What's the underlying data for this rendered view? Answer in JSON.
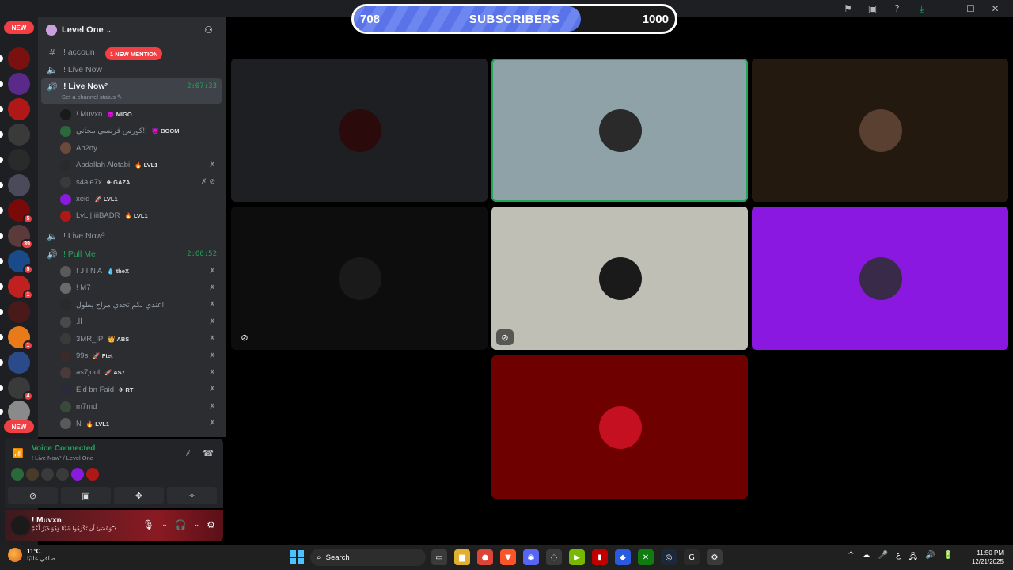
{
  "window": {
    "icons": [
      "flag-icon",
      "inbox-icon",
      "help-icon",
      "download-icon",
      "minimize-icon",
      "maximize-icon",
      "close-icon"
    ]
  },
  "subscriber_goal": {
    "current": "708",
    "label": "SUBSCRIBERS",
    "goal": "1000",
    "progress": 0.708,
    "fill_color": "#5a73e8"
  },
  "rail": {
    "new_top": "NEW",
    "new_bottom": "NEW",
    "servers": [
      {
        "name": "server-1",
        "badge": "",
        "color": "#7a1010"
      },
      {
        "name": "server-2",
        "badge": "",
        "color": "#5a2a8a"
      },
      {
        "name": "server-3",
        "badge": "",
        "color": "#b01818"
      },
      {
        "name": "server-4",
        "badge": "",
        "color": "#3a3a3a"
      },
      {
        "name": "server-5",
        "badge": "",
        "color": "#2a2a2a"
      },
      {
        "name": "server-6",
        "badge": "",
        "color": "#4a4a5a"
      },
      {
        "name": "server-7",
        "badge": "5",
        "color": "#7a0a0a"
      },
      {
        "name": "server-8",
        "badge": "39",
        "color": "#5a3a3a"
      },
      {
        "name": "server-9",
        "badge": "5",
        "color": "#1a4a8a"
      },
      {
        "name": "server-10",
        "badge": "1",
        "color": "#c02020"
      },
      {
        "name": "server-11",
        "badge": "",
        "color": "#4a1a1a"
      },
      {
        "name": "server-12",
        "badge": "1",
        "color": "#e87a1a"
      },
      {
        "name": "server-13",
        "badge": "",
        "color": "#2a4a8a"
      },
      {
        "name": "server-14",
        "badge": "4",
        "color": "#3a3a3a"
      },
      {
        "name": "server-15",
        "badge": "",
        "color": "#8a8a8a"
      }
    ]
  },
  "guild": {
    "name": "Level One",
    "mention_pill": "1 NEW MENTION"
  },
  "channels": [
    {
      "prefix": "#",
      "name": "! accoun",
      "type": "text"
    },
    {
      "prefix": "🔊",
      "name": "! Live Now",
      "type": "voice"
    },
    {
      "prefix": "🔊",
      "name": "! Live Now²",
      "type": "voice-active",
      "timer": "2:07:33",
      "status": "Set a channel status ✎"
    },
    {
      "prefix": "🔊",
      "name": "! Live Now³",
      "type": "voice"
    },
    {
      "prefix": "🔊",
      "name": "! Pull Me",
      "type": "voice-live",
      "timer": "2:06:52"
    }
  ],
  "members_live_now_2": [
    {
      "name": "! Muvxn",
      "tag": "😈 MIGO",
      "status": "",
      "color": "#1a1a1a"
    },
    {
      "name": "كورس فرنسي مجاني!!",
      "tag": "😈 BOOM",
      "status": "",
      "color": "#2a6a3a"
    },
    {
      "name": "Ab2dy",
      "tag": "",
      "status": "",
      "color": "#6a4a3a"
    },
    {
      "name": "Abdallah Alotabi",
      "tag": "🔥 LVL1",
      "status": "✗",
      "color": "#2a2a2a"
    },
    {
      "name": "s4ale7x",
      "tag": "✈ GAZA",
      "status": "✗ ⊘",
      "color": "#3a3a3a"
    },
    {
      "name": "xeid",
      "tag": "🚀 LVL1",
      "status": "",
      "color": "#8a1ae0"
    },
    {
      "name": "LvL | iiiBADR",
      "tag": "🔥 LVL1",
      "status": "",
      "color": "#b01818"
    }
  ],
  "members_pull_me": [
    {
      "name": "! J I N A",
      "tag": "💧 theX",
      "status": "✗",
      "color": "#5a5a5a"
    },
    {
      "name": "! M7",
      "tag": "",
      "status": "✗",
      "color": "#6a6a6a"
    },
    {
      "name": "عندي لكم تحدي مراح يطول!!",
      "tag": "",
      "status": "✗",
      "color": "#2a2a2a"
    },
    {
      "name": ".اا",
      "tag": "",
      "status": "✗",
      "color": "#4a4a4a"
    },
    {
      "name": "3MR_IP",
      "tag": "👑 ABS",
      "status": "✗",
      "color": "#3a3a3a"
    },
    {
      "name": "99s",
      "tag": "🚀 Ftet",
      "status": "✗",
      "color": "#3a2a2a"
    },
    {
      "name": "as7joul",
      "tag": "🚀 AS7",
      "status": "✗",
      "color": "#4a3a3a"
    },
    {
      "name": "Eld bn Faid",
      "tag": "✈ RT",
      "status": "✗",
      "color": "#2a2a3a"
    },
    {
      "name": "m7md",
      "tag": "",
      "status": "✗",
      "color": "#3a4a3a"
    },
    {
      "name": "N",
      "tag": "🔥 LVL1",
      "status": "✗",
      "color": "#5a5a5a"
    }
  ],
  "voice": {
    "title": "Voice Connected",
    "subtitle": "! Live Now² / Level One",
    "avatars": [
      "#2a6a3a",
      "#4a3a2a",
      "#3a3a3a",
      "#3a3a3a",
      "#8a1ae0",
      "#b01818"
    ],
    "buttons": [
      "camera-off-icon",
      "screen-share-icon",
      "activities-icon",
      "soundboard-icon"
    ]
  },
  "user": {
    "name": "! Muvxn",
    "status": "وَعَسَىٰ أَن تَكْرَهُوا شَيْئًا وَهُوَ خَيْرٌ لَّكُمْ ۖ •"
  },
  "tiles": [
    {
      "name": "tile-batman",
      "bg": "#1e1f22",
      "av": "#2a0a0a",
      "speaking": false,
      "muted": false
    },
    {
      "name": "tile-speaking",
      "bg": "#8ea2a8",
      "av": "#2a2a2a",
      "speaking": true,
      "muted": false
    },
    {
      "name": "tile-brown",
      "bg": "#24190f",
      "av": "#5a4030",
      "speaking": false,
      "muted": false
    },
    {
      "name": "tile-dark",
      "bg": "#0d0d0d",
      "av": "#1a1a1a",
      "speaking": false,
      "muted": true
    },
    {
      "name": "tile-grey",
      "bg": "#bfbfb6",
      "av": "#1a1a1a",
      "speaking": false,
      "muted": true
    },
    {
      "name": "tile-purple",
      "bg": "#8a18e0",
      "av": "#3a2a4a",
      "speaking": false,
      "muted": false
    },
    {
      "name": "tile-red",
      "bg": "#6e0000",
      "av": "#c41020",
      "speaking": false,
      "muted": false
    }
  ],
  "taskbar": {
    "weather_temp": "11°C",
    "weather_desc": "صافي غالبًا",
    "search_placeholder": "Search",
    "apps": [
      {
        "name": "task-view-icon",
        "color": "#3a3a3a",
        "glyph": "▭"
      },
      {
        "name": "file-explorer-icon",
        "color": "#e0b030",
        "glyph": "▆"
      },
      {
        "name": "chrome-icon",
        "color": "#db4437",
        "glyph": "●"
      },
      {
        "name": "brave-icon",
        "color": "#fb542b",
        "glyph": "▼"
      },
      {
        "name": "discord-icon",
        "color": "#5865f2",
        "glyph": "◉"
      },
      {
        "name": "obs-icon",
        "color": "#3a3a3a",
        "glyph": "◌"
      },
      {
        "name": "nvidia-icon",
        "color": "#76b900",
        "glyph": "▶"
      },
      {
        "name": "app-red-icon",
        "color": "#c00000",
        "glyph": "▮"
      },
      {
        "name": "app-blue-icon",
        "color": "#2a5ae0",
        "glyph": "◆"
      },
      {
        "name": "xbox-icon",
        "color": "#107c10",
        "glyph": "✕"
      },
      {
        "name": "steam-icon",
        "color": "#1b2838",
        "glyph": "◎"
      },
      {
        "name": "logitech-icon",
        "color": "#2a2a2a",
        "glyph": "G"
      },
      {
        "name": "app-alert-icon",
        "color": "#3a3a3a",
        "glyph": "⚙"
      }
    ],
    "tray": [
      "^",
      "☁",
      "🎤",
      "ع",
      "🖧",
      "🔊",
      "🔋"
    ],
    "time": "11:50 PM",
    "date": "12/21/2025"
  }
}
